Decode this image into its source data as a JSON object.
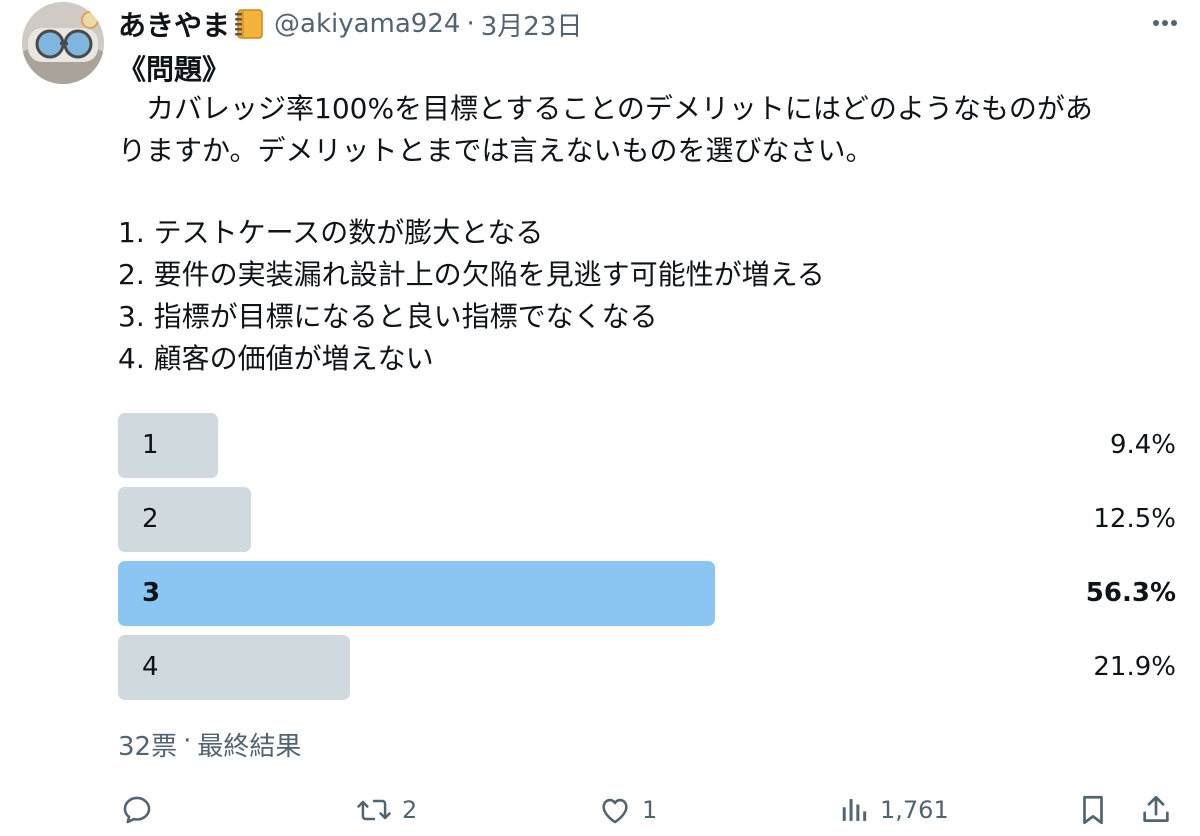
{
  "author": {
    "display_name": "あきやま",
    "handle": "@akiyama924",
    "separator": "·",
    "date": "3月23日"
  },
  "tweet": {
    "title": "《問題》",
    "line1": "　カバレッジ率100%を目標とすることのデメリットにはどのようなものがあ",
    "line2": "りますか。デメリットとまでは言えないものを選びなさい。",
    "choice1": "1. テストケースの数が膨大となる",
    "choice2": "2. 要件の実装漏れ設計上の欠陥を見逃す可能性が増える",
    "choice3": "3. 指標が目標になると良い指標でなくなる",
    "choice4": "4. 顧客の価値が増えない"
  },
  "poll": {
    "options": [
      {
        "label": "1",
        "percent_text": "9.4%",
        "percent": 9.4,
        "winner": false
      },
      {
        "label": "2",
        "percent_text": "12.5%",
        "percent": 12.5,
        "winner": false
      },
      {
        "label": "3",
        "percent_text": "56.3%",
        "percent": 56.3,
        "winner": true
      },
      {
        "label": "4",
        "percent_text": "21.9%",
        "percent": 21.9,
        "winner": false
      }
    ],
    "votes": "32票",
    "separator": "·",
    "status": "最終結果"
  },
  "actions": {
    "reply_count": "",
    "retweet_count": "2",
    "like_count": "1",
    "views_count": "1,761"
  },
  "icons": {
    "more": "more-options-icon",
    "notebook": "notebook-emoji-icon",
    "reply": "reply-icon",
    "retweet": "retweet-icon",
    "like": "heart-icon",
    "views": "views-icon",
    "bookmark": "bookmark-icon",
    "share": "share-icon"
  },
  "colors": {
    "text": "#0f1419",
    "secondary": "#536471",
    "bar": "#cfd9de",
    "bar_winner": "#8bc5f2"
  }
}
